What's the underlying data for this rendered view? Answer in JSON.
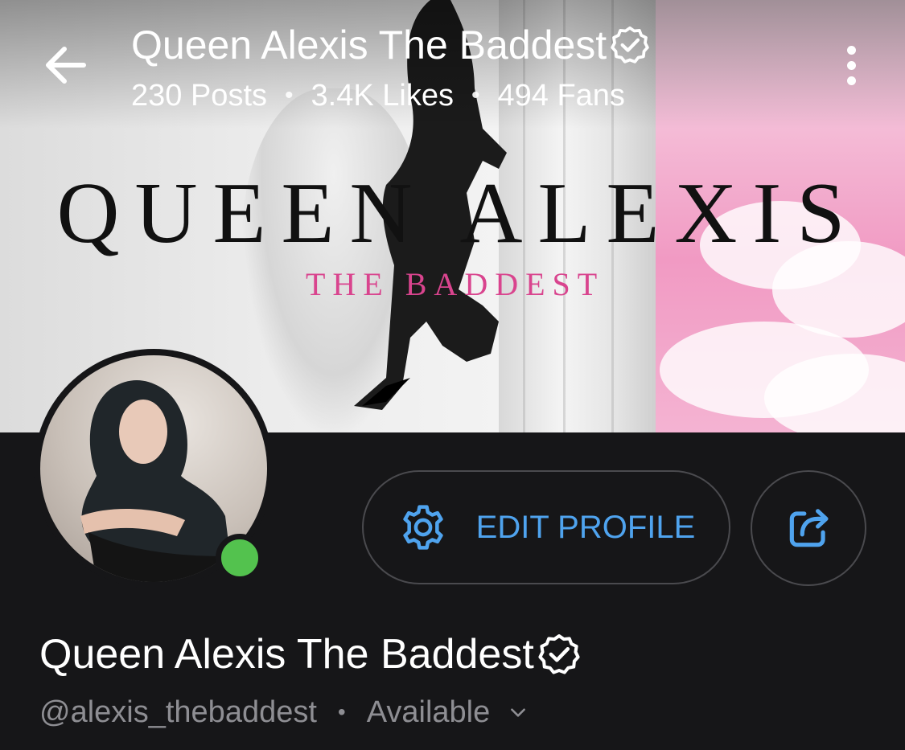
{
  "header": {
    "title": "Queen Alexis The Baddest",
    "stats": {
      "posts": "230 Posts",
      "likes": "3.4K Likes",
      "fans": "494 Fans"
    }
  },
  "cover": {
    "brand_main": "QUEEN ALEXIS",
    "brand_sub": "THE BADDEST"
  },
  "profile": {
    "display_name": "Queen Alexis The Baddest",
    "username": "@alexis_thebaddest",
    "status": "Available",
    "online": true
  },
  "actions": {
    "edit_profile_label": "EDIT PROFILE"
  },
  "icons": {
    "back": "arrow-left-icon",
    "more": "more-vertical-icon",
    "verified": "verified-badge-icon",
    "settings": "gear-icon",
    "share": "share-icon",
    "chevron": "chevron-down-icon"
  },
  "colors": {
    "background": "#161618",
    "accent": "#4fa3ee",
    "online": "#53c24e",
    "brand_pink": "#d9448e",
    "muted_text": "#8e8e93"
  }
}
